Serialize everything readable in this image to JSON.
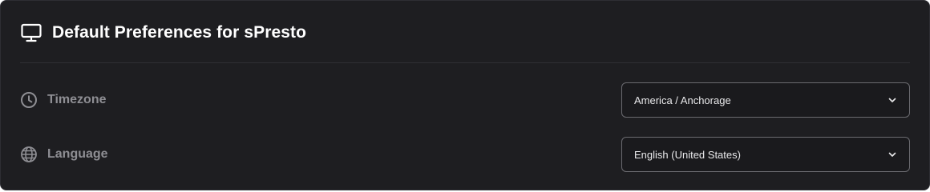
{
  "header": {
    "title": "Default Preferences for sPresto",
    "icon": "monitor-icon"
  },
  "settings": [
    {
      "label": "Timezone",
      "icon": "clock-icon",
      "value": "America / Anchorage"
    },
    {
      "label": "Language",
      "icon": "globe-icon",
      "value": "English (United States)"
    }
  ],
  "colors": {
    "card_background": "#1e1e21",
    "label_gray": "#8e8e93",
    "select_border": "#6b6b70"
  }
}
